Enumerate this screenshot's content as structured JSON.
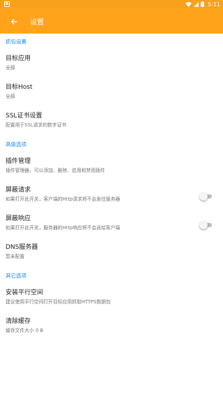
{
  "status_bar": {
    "notification_icon": "A",
    "time": "5:11"
  },
  "app_bar": {
    "title": "设置",
    "back_icon": "arrow-back-icon"
  },
  "sections": [
    {
      "header": "抓包设置",
      "items": [
        {
          "title": "目标应用",
          "summary": "全部"
        },
        {
          "title": "目标Host",
          "summary": "全部"
        },
        {
          "title": "SSL证书设置",
          "summary": "配置用于SSL请求的数字证书"
        }
      ]
    },
    {
      "header": "高级选项",
      "items": [
        {
          "title": "插件管理",
          "summary": "插件管理器，可以添加、删除、启用和禁用插件"
        },
        {
          "title": "屏蔽请求",
          "summary": "如果打开此开关，客户端的Http请求将不会发往服务器",
          "switch_on": false
        },
        {
          "title": "屏蔽响应",
          "summary": "如果打开此开关，服务器的Http响应将不会返给客户端",
          "switch_on": false
        },
        {
          "title": "DNS服务器",
          "summary": "暂未配置"
        }
      ]
    },
    {
      "header": "其它选项",
      "items": [
        {
          "title": "安装平行空间",
          "summary": "建议使用平行空间打开目标应用抓取HTTPS数据包"
        },
        {
          "title": "清除缓存",
          "summary": "缓存文件大小 0 B"
        }
      ]
    }
  ],
  "colors": {
    "app_bar": "#ffa31a",
    "status_bar": "#f7a11d",
    "section_header": "#1e88e5"
  }
}
